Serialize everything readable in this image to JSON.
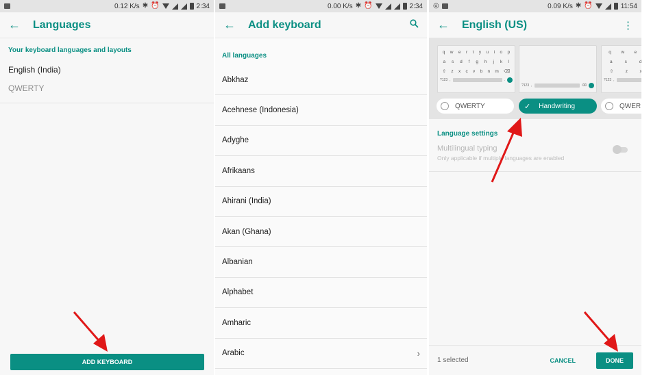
{
  "panel1": {
    "status": {
      "speed": "0.12 K/s",
      "time": "2:34"
    },
    "title": "Languages",
    "section_label": "Your keyboard languages and layouts",
    "language": "English (India)",
    "layout": "QWERTY",
    "add_button": "ADD KEYBOARD"
  },
  "panel2": {
    "status": {
      "speed": "0.00 K/s",
      "time": "2:34"
    },
    "title": "Add keyboard",
    "section_label": "All languages",
    "languages": [
      "Abkhaz",
      "Acehnese (Indonesia)",
      "Adyghe",
      "Afrikaans",
      "Ahirani (India)",
      "Akan (Ghana)",
      "Albanian",
      "Alphabet",
      "Amharic",
      "Arabic"
    ]
  },
  "panel3": {
    "status": {
      "speed": "0.09 K/s",
      "time": "11:54"
    },
    "title": "English (US)",
    "keyboard_rows": {
      "row1": [
        "q",
        "w",
        "e",
        "r",
        "t",
        "y",
        "u",
        "i",
        "o",
        "p"
      ],
      "row2": [
        "a",
        "s",
        "d",
        "f",
        "g",
        "h",
        "j",
        "k",
        "l"
      ],
      "row3": [
        "⇧",
        "z",
        "x",
        "c",
        "v",
        "b",
        "n",
        "m",
        "⌫"
      ],
      "bar_label": "?123"
    },
    "layouts": [
      "QWERTY",
      "Handwriting",
      "QWER"
    ],
    "selected_layout": "Handwriting",
    "section_label": "Language settings",
    "toggle_title": "Multilingual typing",
    "toggle_sub": "Only applicable if multiple languages are enabled",
    "toggle_on": false,
    "selected_count": "1 selected",
    "cancel": "CANCEL",
    "done": "DONE"
  },
  "colors": {
    "accent": "#0a8f83",
    "arrow": "#e01818"
  },
  "icons": [
    "back-arrow-icon",
    "search-icon",
    "more-vert-icon",
    "chevron-right-icon",
    "check-icon",
    "bluetooth-icon",
    "alarm-icon",
    "wifi-icon",
    "signal-icon",
    "battery-icon"
  ]
}
